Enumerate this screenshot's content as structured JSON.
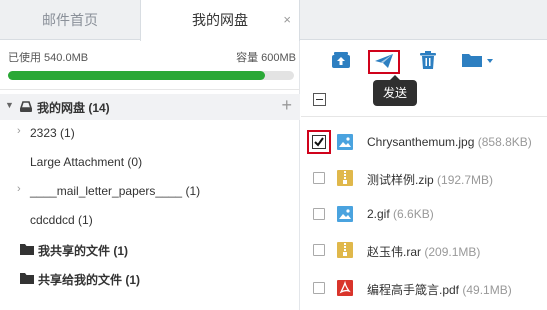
{
  "tabs": [
    {
      "label": "邮件首页"
    },
    {
      "label": "我的网盘",
      "close": "×"
    }
  ],
  "usage": {
    "used": "已使用 540.0MB",
    "capacity": "容量 600MB",
    "fill_fraction": 0.9
  },
  "tree": {
    "root": {
      "label": "我的网盘 (14)",
      "add": "+"
    },
    "nodes": [
      {
        "label": "2323 (1)"
      },
      {
        "label": "Large Attachment (0)"
      },
      {
        "label": "____mail_letter_papers____ (1)"
      },
      {
        "label": "cdcddcd (1)"
      }
    ],
    "shared": [
      {
        "label": "我共享的文件 (1)"
      },
      {
        "label": "共享给我的文件 (1)"
      }
    ]
  },
  "toolbar": {
    "tooltip": "发送",
    "buttons": [
      {
        "icon": "upload-icon"
      },
      {
        "icon": "send-icon"
      },
      {
        "icon": "trash-icon"
      },
      {
        "icon": "folder-dropdown-icon"
      }
    ]
  },
  "files": [
    {
      "name": "Chrysanthemum.jpg",
      "size": "(858.8KB)",
      "type": "image",
      "color": "#4aa3df",
      "checked": true
    },
    {
      "name": "测试样例.zip",
      "size": "(192.7MB)",
      "type": "zip",
      "color": "#e0b84b",
      "checked": false
    },
    {
      "name": "2.gif",
      "size": "(6.6KB)",
      "type": "image",
      "color": "#4aa3df",
      "checked": false
    },
    {
      "name": "赵玉伟.rar",
      "size": "(209.1MB)",
      "type": "zip",
      "color": "#e0b84b",
      "checked": false
    },
    {
      "name": "编程高手箴言.pdf",
      "size": "(49.1MB)",
      "type": "pdf",
      "color": "#d9342b",
      "checked": false
    }
  ]
}
